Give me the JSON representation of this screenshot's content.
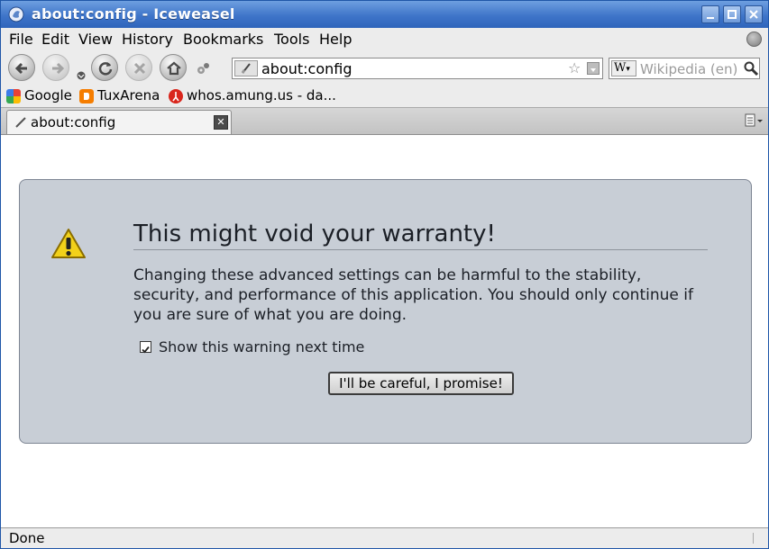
{
  "window": {
    "title": "about:config - Iceweasel"
  },
  "menu": [
    "File",
    "Edit",
    "View",
    "History",
    "Bookmarks",
    "Tools",
    "Help"
  ],
  "nav": {
    "url": "about:config",
    "search_placeholder": "Wikipedia (en)",
    "search_engine_glyph": "W"
  },
  "bookmarks": [
    {
      "label": "Google"
    },
    {
      "label": "TuxArena"
    },
    {
      "label": "whos.amung.us - da..."
    }
  ],
  "tab": {
    "label": "about:config"
  },
  "warning": {
    "title": "This might void your warranty!",
    "text": "Changing these advanced settings can be harmful to the stability, security, and performance of this application. You should only continue if you are sure of what you are doing.",
    "checkbox_label": "Show this warning next time",
    "checkbox_checked": true,
    "button_label": "I'll be careful, I promise!"
  },
  "status": {
    "text": "Done"
  },
  "colors": {
    "titlebar": "#3f75c9",
    "warning_box": "#c8ced6",
    "warning_icon": "#f2d11a"
  }
}
